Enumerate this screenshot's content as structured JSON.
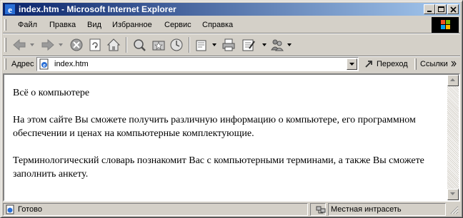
{
  "window": {
    "title": "index.htm - Microsoft Internet Explorer"
  },
  "menu": {
    "items": [
      {
        "label": "Файл"
      },
      {
        "label": "Правка"
      },
      {
        "label": "Вид"
      },
      {
        "label": "Избранное"
      },
      {
        "label": "Сервис"
      },
      {
        "label": "Справка"
      }
    ]
  },
  "toolbar": {
    "buttons": [
      {
        "icon": "back-arrow-icon"
      },
      {
        "icon": "forward-arrow-icon"
      },
      {
        "icon": "stop-icon"
      },
      {
        "icon": "refresh-icon"
      },
      {
        "icon": "home-icon"
      },
      {
        "icon": "search-icon"
      },
      {
        "icon": "favorites-icon"
      },
      {
        "icon": "history-icon"
      },
      {
        "icon": "mail-icon"
      },
      {
        "icon": "print-icon"
      },
      {
        "icon": "edit-icon"
      },
      {
        "icon": "messenger-icon"
      }
    ]
  },
  "address": {
    "label": "Адрес",
    "value": "index.htm",
    "go_label": "Переход",
    "links_label": "Ссылки"
  },
  "page": {
    "paragraphs": [
      "Всё о компьютере",
      "На этом сайте Вы сможете получить различную информацию о компьютере, его программном обеспечении и ценах на компьютерные комплектующие.",
      "Терминологический словарь познакомит Вас с компьютерными терминами, а также Вы сможете заполнить анкету."
    ]
  },
  "status": {
    "text": "Готово",
    "zone": "Местная интрасеть"
  },
  "colors": {
    "title_gradient_start": "#0a246a",
    "title_gradient_end": "#a6caf0",
    "chrome": "#d4d0c8"
  }
}
